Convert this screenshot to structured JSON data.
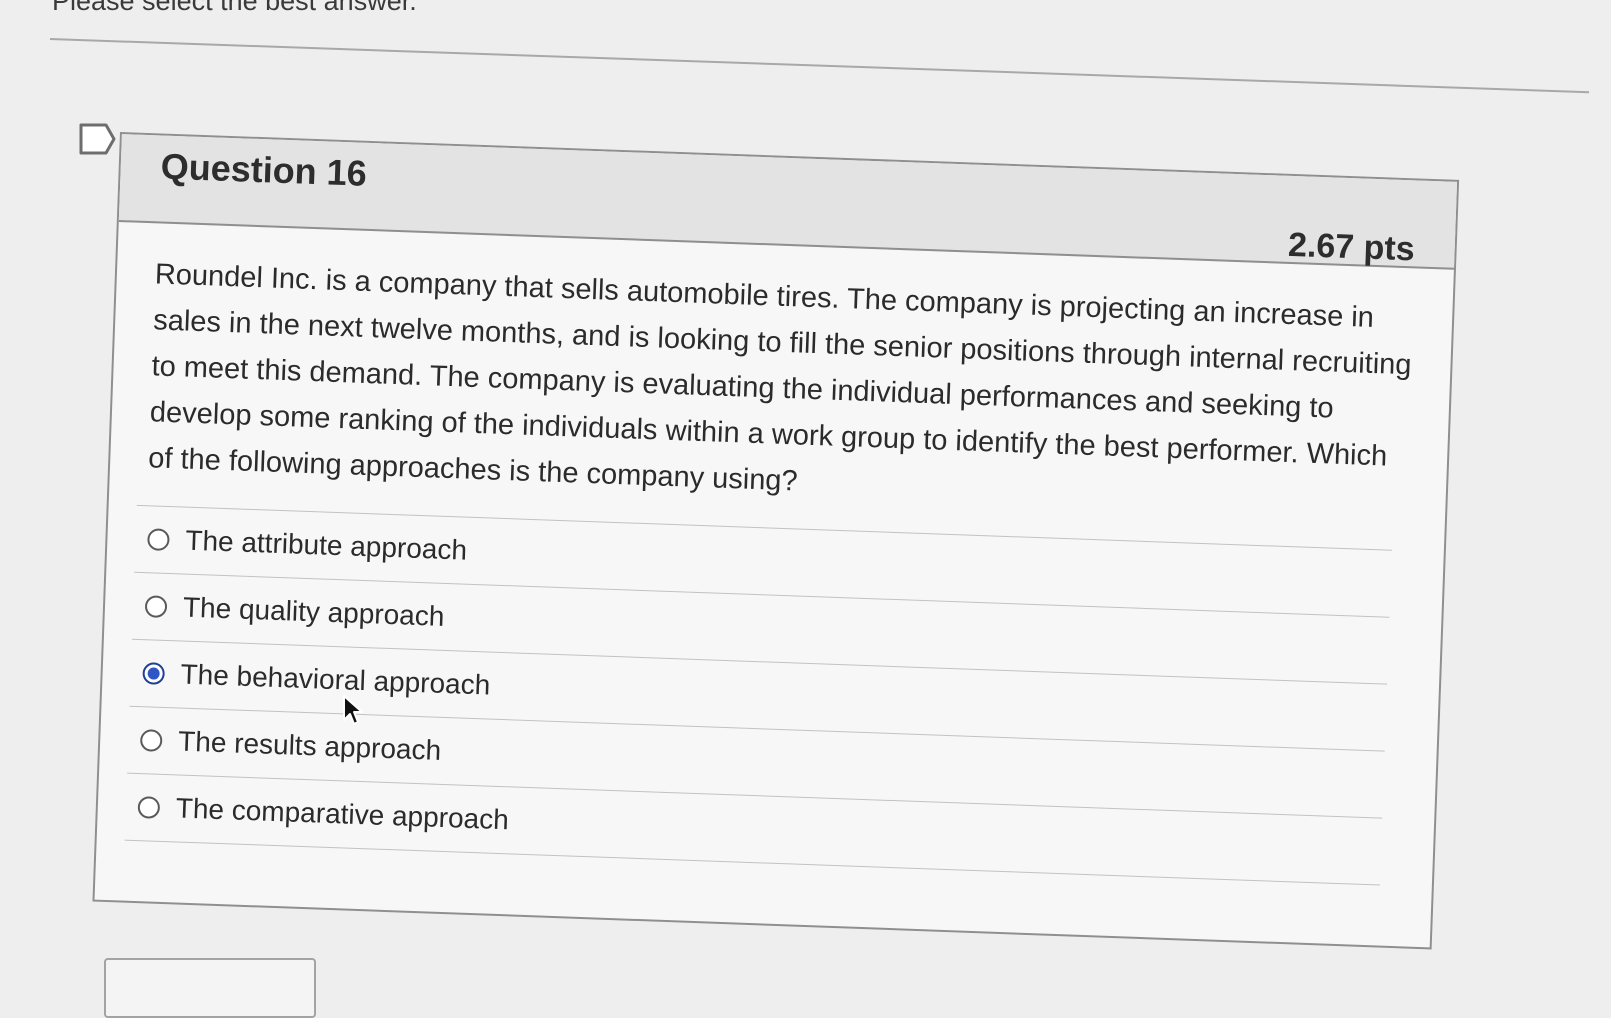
{
  "header": {
    "instruction": "Please select the best answer."
  },
  "question": {
    "title": "Question 16",
    "points": "2.67 pts",
    "text": "Roundel Inc. is a company that sells automobile tires. The company is projecting an increase in sales in the next twelve months, and is looking to fill the senior positions through internal recruiting to meet this demand. The company is evaluating the individual performances and seeking to develop some ranking of the individuals within a work group to identify the best performer. Which of the following approaches is the company using?",
    "answers": [
      {
        "label": "The attribute approach",
        "selected": false
      },
      {
        "label": "The quality approach",
        "selected": false
      },
      {
        "label": "The behavioral approach",
        "selected": true
      },
      {
        "label": "The results approach",
        "selected": false
      },
      {
        "label": "The comparative approach",
        "selected": false
      }
    ]
  },
  "icons": {
    "flag": "bookmark-flag-icon",
    "cursor": "mouse-pointer-icon"
  },
  "colors": {
    "selected_radio": "#2e56c7",
    "card_header": "#e3e3e3",
    "page_background": "#eeeeee"
  }
}
